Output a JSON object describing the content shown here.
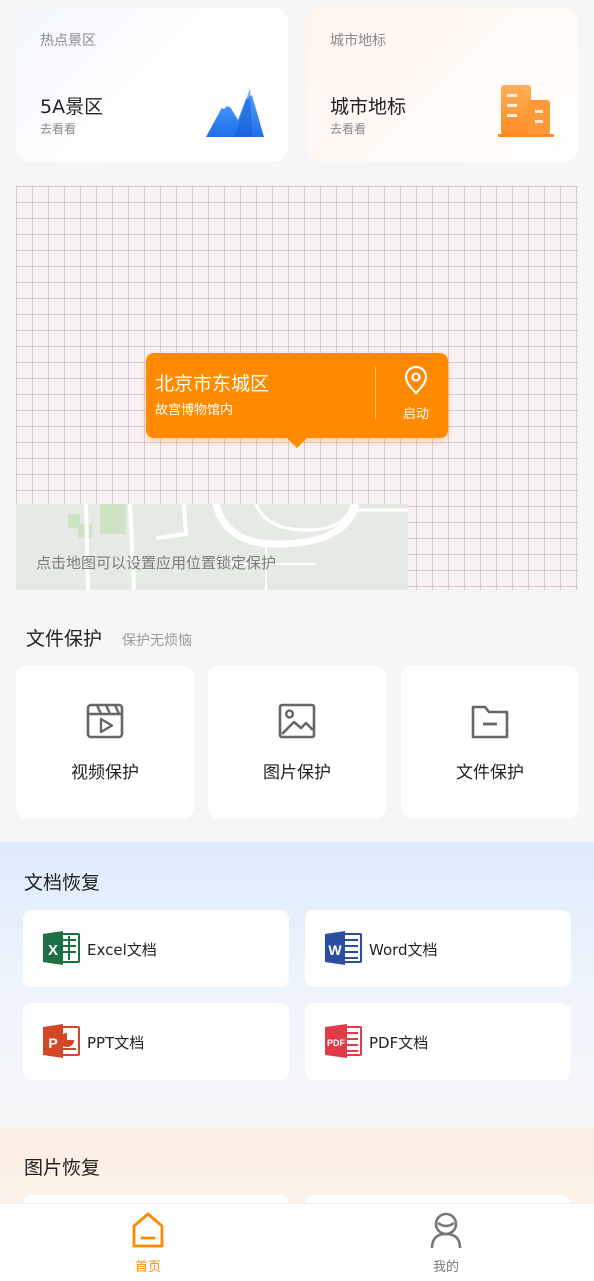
{
  "hot_spots": {
    "scenic": {
      "category": "热点景区",
      "title": "5A景区",
      "action": "去看看",
      "icon": "mountain-icon"
    },
    "landmark": {
      "category": "城市地标",
      "title": "城市地标",
      "action": "去看看",
      "icon": "building-icon"
    }
  },
  "map": {
    "location_city": "北京市东城区",
    "location_place": "故宫博物馆内",
    "start_label": "启动",
    "start_icon": "location-pin-icon",
    "hint": "点击地图可以设置应用位置锁定保护"
  },
  "file_protection": {
    "title": "文件保护",
    "subtitle": "保护无烦恼",
    "items": [
      {
        "label": "视频保护",
        "icon": "video-icon"
      },
      {
        "label": "图片保护",
        "icon": "image-icon"
      },
      {
        "label": "文件保护",
        "icon": "folder-icon"
      }
    ]
  },
  "doc_recovery": {
    "title": "文档恢复",
    "items": [
      {
        "label": "Excel文档",
        "icon": "excel-icon"
      },
      {
        "label": "Word文档",
        "icon": "word-icon"
      },
      {
        "label": "PPT文档",
        "icon": "ppt-icon"
      },
      {
        "label": "PDF文档",
        "icon": "pdf-icon"
      }
    ]
  },
  "image_recovery": {
    "title": "图片恢复"
  },
  "nav": {
    "items": [
      {
        "label": "首页",
        "icon": "home-icon",
        "active": true
      },
      {
        "label": "我的",
        "icon": "profile-icon",
        "active": false
      }
    ]
  },
  "colors": {
    "accent": "#ff8a00",
    "excel": "#1d7044",
    "word": "#2b4ea0",
    "ppt": "#d24726",
    "pdf": "#e23b48",
    "scenic_blue": "#2f7bf0"
  }
}
